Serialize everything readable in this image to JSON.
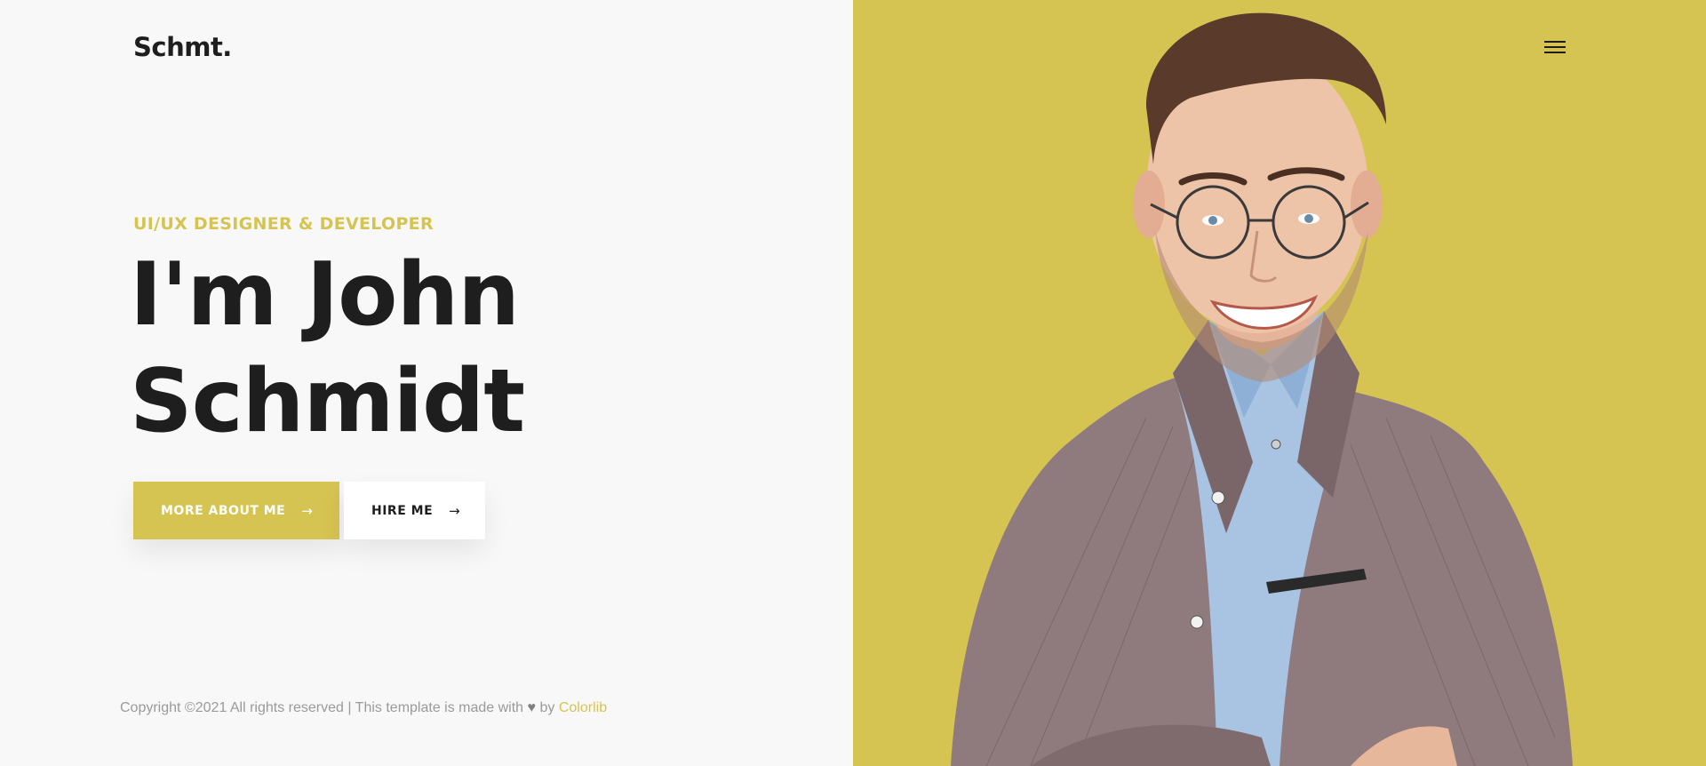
{
  "brand": {
    "logo": "Schmt."
  },
  "hero": {
    "subtitle": "UI/UX DESIGNER & DEVELOPER",
    "headline_line1": "I'm John",
    "headline_line2": "Schmidt",
    "primary_button": "MORE ABOUT ME",
    "secondary_button": "HIRE ME",
    "arrow": "→"
  },
  "footer": {
    "text_before": "Copyright ©2021 All rights reserved | This template is made with",
    "heart": "♥",
    "by": "by",
    "link": "Colorlib"
  },
  "colors": {
    "accent": "#d5c452",
    "text": "#1e1e1e",
    "background": "#f8f8f8"
  },
  "icons": {
    "menu": "hamburger-menu-icon",
    "arrow": "arrow-right-icon",
    "heart": "heart-icon"
  }
}
